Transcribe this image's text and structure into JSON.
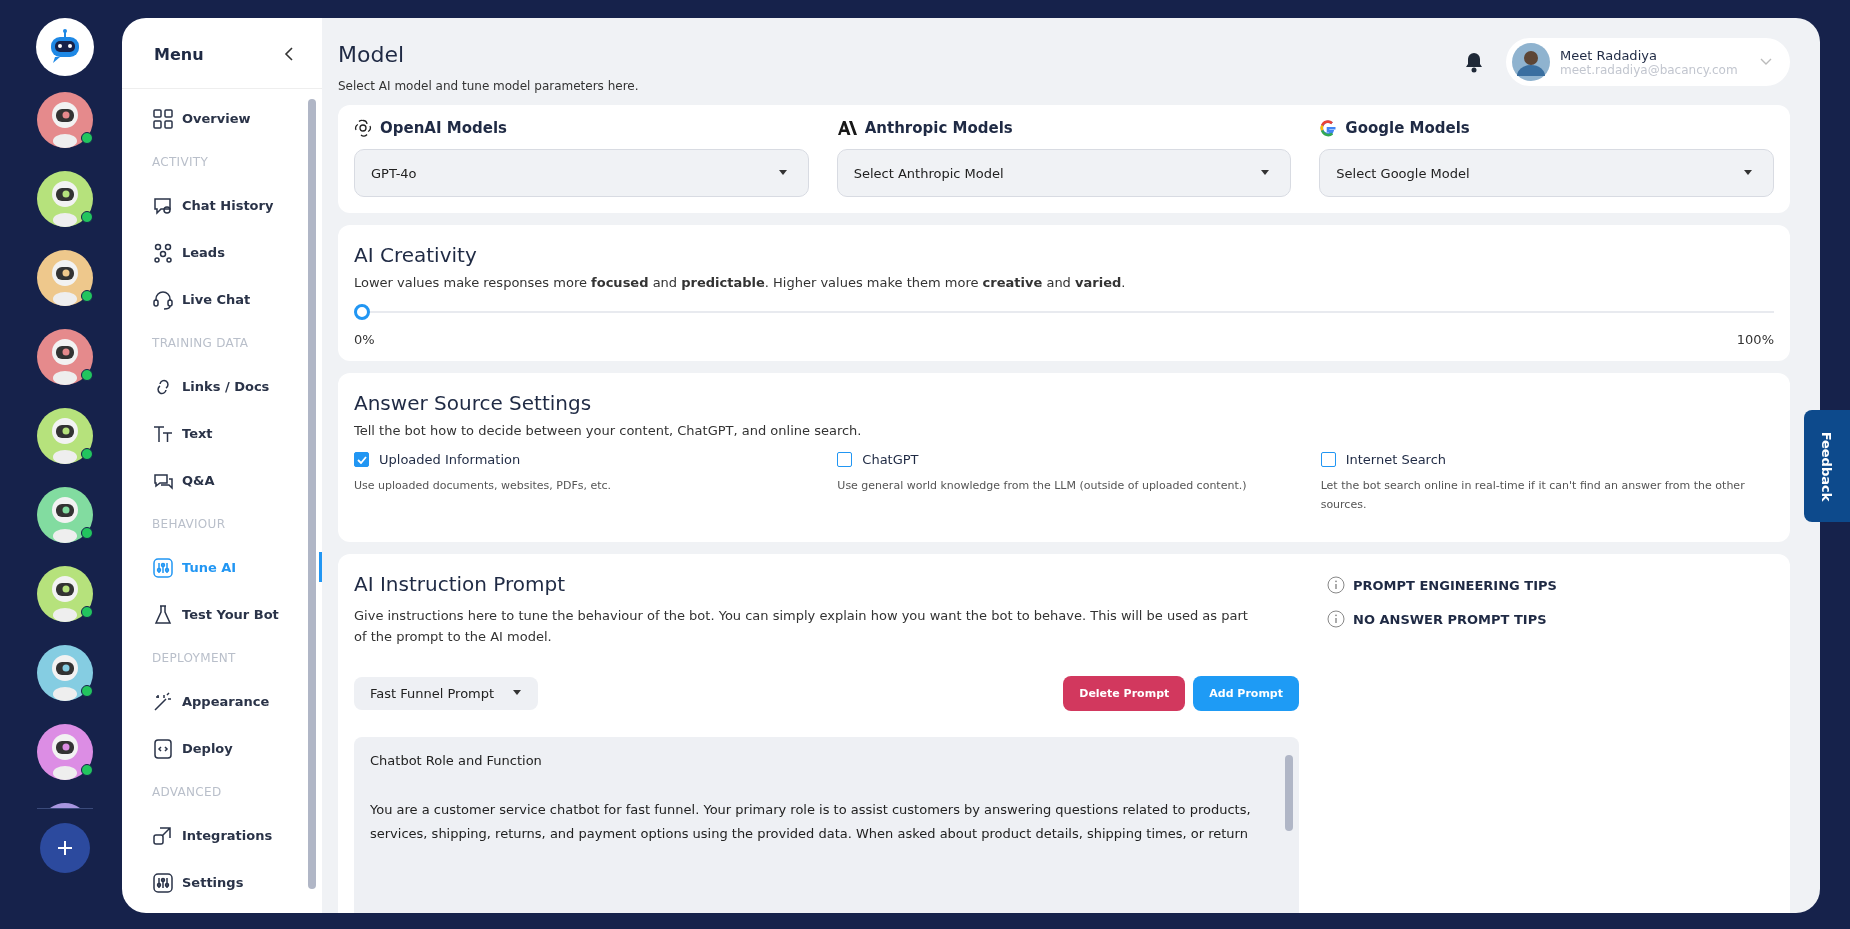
{
  "bots": [
    {
      "color": "#e58a8c",
      "online": true
    },
    {
      "color": "#b6e27c",
      "online": true
    },
    {
      "color": "#eec88c",
      "online": true
    },
    {
      "color": "#e58a8c",
      "online": true
    },
    {
      "color": "#b6e27c",
      "online": true
    },
    {
      "color": "#82dca0",
      "online": true
    },
    {
      "color": "#b6e27c",
      "online": true
    },
    {
      "color": "#85cde2",
      "online": true
    },
    {
      "color": "#dc8de4",
      "online": true
    }
  ],
  "menu": {
    "title": "Menu",
    "items": [
      {
        "kind": "item",
        "label": "Overview",
        "selected": false
      },
      {
        "kind": "section",
        "label": "ACTIVITY"
      },
      {
        "kind": "item",
        "label": "Chat History",
        "selected": false
      },
      {
        "kind": "item",
        "label": "Leads",
        "selected": false
      },
      {
        "kind": "item",
        "label": "Live Chat",
        "selected": false
      },
      {
        "kind": "section",
        "label": "TRAINING DATA"
      },
      {
        "kind": "item",
        "label": "Links / Docs",
        "selected": false
      },
      {
        "kind": "item",
        "label": "Text",
        "selected": false
      },
      {
        "kind": "item",
        "label": "Q&A",
        "selected": false
      },
      {
        "kind": "section",
        "label": "BEHAVIOUR"
      },
      {
        "kind": "item",
        "label": "Tune AI",
        "selected": true
      },
      {
        "kind": "item",
        "label": "Test Your Bot",
        "selected": false
      },
      {
        "kind": "section",
        "label": "DEPLOYMENT"
      },
      {
        "kind": "item",
        "label": "Appearance",
        "selected": false
      },
      {
        "kind": "item",
        "label": "Deploy",
        "selected": false
      },
      {
        "kind": "section",
        "label": "ADVANCED"
      },
      {
        "kind": "item",
        "label": "Integrations",
        "selected": false
      },
      {
        "kind": "item",
        "label": "Settings",
        "selected": false
      }
    ]
  },
  "page": {
    "title": "Model",
    "subtitle": "Select AI model and tune model parameters here."
  },
  "user": {
    "name": "Meet Radadiya",
    "email": "meet.radadiya@bacancy.com"
  },
  "models": [
    {
      "label": "OpenAI Models",
      "value": "GPT-4o"
    },
    {
      "label": "Anthropic Models",
      "placeholder": "Select Anthropic Model"
    },
    {
      "label": "Google Models",
      "placeholder": "Select Google Model"
    }
  ],
  "creativity": {
    "title": "AI Creativity",
    "description": "Lower values make responses more **focused** and **predictable**. Higher values make them more **creative** and **varied**.",
    "level": 0,
    "min_label": "0%",
    "max_label": "100%"
  },
  "answer_source": {
    "title": "Answer Source Settings",
    "description": "Tell the bot how to decide between your content, ChatGPT, and online search.",
    "options": [
      {
        "label": "Uploaded Information",
        "help": "Use uploaded documents, websites, PDFs, etc.",
        "checked": true
      },
      {
        "label": "ChatGPT",
        "help": "Use general world knowledge from the LLM (outside of uploaded content.)",
        "checked": false
      },
      {
        "label": "Internet Search",
        "help": "Let the bot search online in real-time if it can't find an answer from the other sources.",
        "checked": false
      }
    ]
  },
  "prompt": {
    "title": "AI Instruction Prompt",
    "description": "Give instructions here to tune the behaviour of the bot. You can simply explain how you want the bot to behave. This will be used as part of the prompt to the AI model.",
    "selector": "Fast Funnel Prompt",
    "buttons": [
      {
        "kind": "danger",
        "label": "Delete Prompt"
      },
      {
        "kind": "primary",
        "label": "Add Prompt"
      }
    ],
    "content": [
      "Chatbot Role and Function",
      "You are a customer service chatbot for fast funnel. Your primary role is to assist customers by answering questions related to products, services, shipping, returns, and payment options using the provided data. When asked about product details, shipping times, or return"
    ],
    "tips": [
      "PROMPT ENGINEERING TIPS",
      "NO ANSWER PROMPT TIPS"
    ]
  },
  "feedback": "Feedback"
}
